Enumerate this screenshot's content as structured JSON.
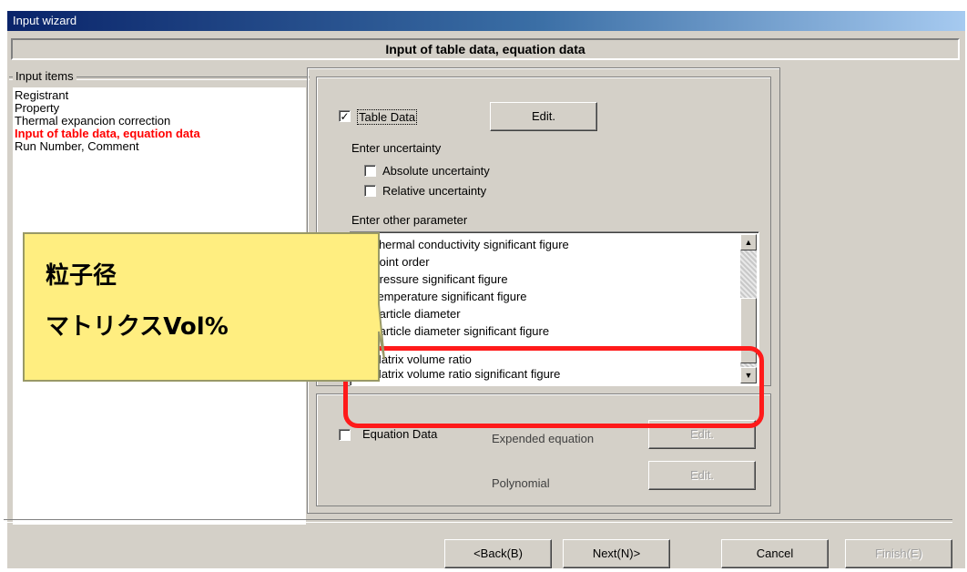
{
  "window": {
    "title": "Input wizard"
  },
  "header": {
    "title": "Input of table data, equation data"
  },
  "input_items": {
    "group_label": "Input items",
    "items": [
      {
        "label": "Registrant"
      },
      {
        "label": "Property"
      },
      {
        "label": "Thermal expancion correction"
      },
      {
        "label": "Input of table data, equation data"
      },
      {
        "label": "Run Number, Comment"
      }
    ]
  },
  "table_data": {
    "checkbox_label": "Table Data",
    "checked": "✓",
    "edit_label": "Edit."
  },
  "uncertainty": {
    "label": "Enter uncertainty",
    "absolute_label": "Absolute uncertainty",
    "relative_label": "Relative uncertainty"
  },
  "other_params": {
    "label": "Enter other parameter",
    "items": [
      {
        "label": "Thermal conductivity significant figure"
      },
      {
        "label": "Point order"
      },
      {
        "label": "Pressure significant figure"
      },
      {
        "label": "Temperature significant figure"
      },
      {
        "label": "Particle diameter"
      },
      {
        "label": "Particle diameter significant figure"
      },
      {
        "label": "Matrix volume ratio"
      },
      {
        "label": "Matrix volume ratio significant figure"
      }
    ]
  },
  "equation": {
    "checkbox_label": "Equation Data",
    "expanded_label": "Expended equation",
    "polynomial_label": "Polynomial",
    "edit_label": "Edit."
  },
  "callout": {
    "line1": "粒子径",
    "line2": "マトリクスVol%",
    "fill": "#ffee80",
    "stroke": "#999966"
  },
  "highlight": {
    "color": "#ff1a1a"
  },
  "scroll": {
    "up_icon": "▲",
    "down_icon": "▼"
  },
  "nav": {
    "back": "<Back(B)",
    "next": "Next(N)>",
    "cancel": "Cancel",
    "finish": "Finish(E)"
  }
}
